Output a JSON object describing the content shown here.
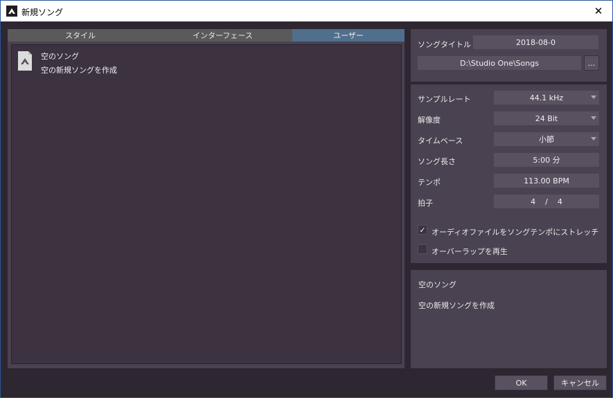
{
  "window": {
    "title": "新規ソング"
  },
  "tabs": [
    {
      "label": "スタイル"
    },
    {
      "label": "インターフェース"
    },
    {
      "label": "ユーザー"
    }
  ],
  "templates": [
    {
      "name": "空のソング",
      "description": "空の新規ソングを作成"
    }
  ],
  "song": {
    "title_label": "ソングタイトル",
    "title_value": "2018-08-0",
    "path_value": "D:\\Studio One\\Songs",
    "browse_label": "..."
  },
  "settings": {
    "sample_rate_label": "サンプルレート",
    "sample_rate_value": "44.1 kHz",
    "resolution_label": "解像度",
    "resolution_value": "24 Bit",
    "timebase_label": "タイムベース",
    "timebase_value": "小節",
    "length_label": "ソング長さ",
    "length_value": "5:00 分",
    "tempo_label": "テンポ",
    "tempo_value": "113.00 BPM",
    "signature_label": "拍子",
    "signature_num": "4",
    "signature_sep": "/",
    "signature_den": "4",
    "stretch_label": "オーディオファイルをソングテンポにストレッチ",
    "stretch_checked": true,
    "overlap_label": "オーバーラップを再生",
    "overlap_checked": false
  },
  "description": {
    "title": "空のソング",
    "text": "空の新規ソングを作成"
  },
  "buttons": {
    "ok": "OK",
    "cancel": "キャンセル"
  },
  "icons": {
    "app": "studio-one-icon",
    "close": "close-icon",
    "template": "song-template-icon",
    "check": "check-icon"
  },
  "colors": {
    "background": "#2e2631",
    "panel": "#4a4250",
    "field": "#5a5160",
    "active_tab": "#4f6f8c"
  }
}
